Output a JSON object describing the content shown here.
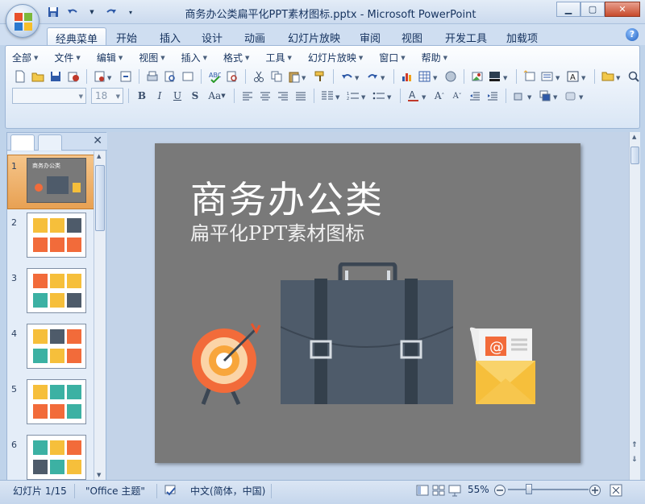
{
  "window": {
    "title": "商务办公类扁平化PPT素材图标.pptx - Microsoft PowerPoint"
  },
  "ribbon_tabs": [
    "经典菜单",
    "开始",
    "插入",
    "设计",
    "动画",
    "幻灯片放映",
    "审阅",
    "视图",
    "开发工具",
    "加载项"
  ],
  "classic_menu": [
    "全部",
    "文件",
    "编辑",
    "视图",
    "插入",
    "格式",
    "工具",
    "幻灯片放映",
    "窗口",
    "帮助"
  ],
  "font_size": "18",
  "slide": {
    "title": "商务办公类",
    "subtitle": "扁平化PPT素材图标"
  },
  "thumbnails": [
    {
      "num": "1",
      "title": "商务办公类"
    },
    {
      "num": "2"
    },
    {
      "num": "3"
    },
    {
      "num": "4"
    },
    {
      "num": "5"
    },
    {
      "num": "6"
    }
  ],
  "status": {
    "slide_info": "幻灯片 1/15",
    "theme": "\"Office 主题\"",
    "language": "中文(简体，中国)",
    "zoom": "55%"
  },
  "colors": {
    "slide_bg": "#797979",
    "target_orange": "#f26b3a",
    "briefcase": "#4e5b6a",
    "envelope_yellow": "#f6bf3b"
  }
}
